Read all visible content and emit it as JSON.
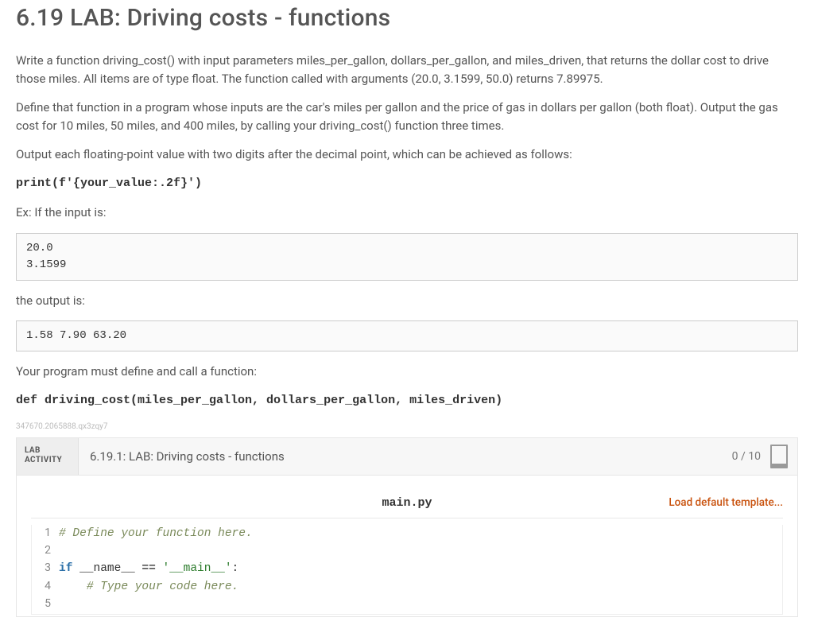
{
  "title": "6.19 LAB: Driving costs - functions",
  "para1": "Write a function driving_cost() with input parameters miles_per_gallon, dollars_per_gallon, and miles_driven, that returns the dollar cost to drive those miles. All items are of type float. The function called with arguments (20.0, 3.1599, 50.0) returns 7.89975.",
  "para2": "Define that function in a program whose inputs are the car's miles per gallon and the price of gas in dollars per gallon (both float). Output the gas cost for 10 miles, 50 miles, and 400 miles, by calling your driving_cost() function three times.",
  "para3": "Output each floating-point value with two digits after the decimal point, which can be achieved as follows:",
  "print_line": "print(f'{your_value:.2f}')",
  "ex_if_input": "Ex: If the input is:",
  "input_box": "20.0\n3.1599",
  "the_output_is": "the output is:",
  "output_box": "1.58 7.90 63.20",
  "must_define": "Your program must define and call a function:",
  "def_line": "def driving_cost(miles_per_gallon, dollars_per_gallon, miles_driven)",
  "tiny_id": "347670.2065888.qx3zqy7",
  "lab": {
    "badge_line1": "LAB",
    "badge_line2": "ACTIVITY",
    "title": "6.19.1: LAB: Driving costs - functions",
    "score": "0 / 10",
    "filename": "main.py",
    "load_template": "Load default template...",
    "code": {
      "l1_comment": "# Define your function here.",
      "l3_kw": "if",
      "l3_name": " __name__ ",
      "l3_op": "==",
      "l3_str": " '__main__'",
      "l3_colon": ":",
      "l4_indent": "    ",
      "l4_comment": "# Type your code here.",
      "line_numbers": [
        "1",
        "2",
        "3",
        "4",
        "5"
      ]
    }
  }
}
